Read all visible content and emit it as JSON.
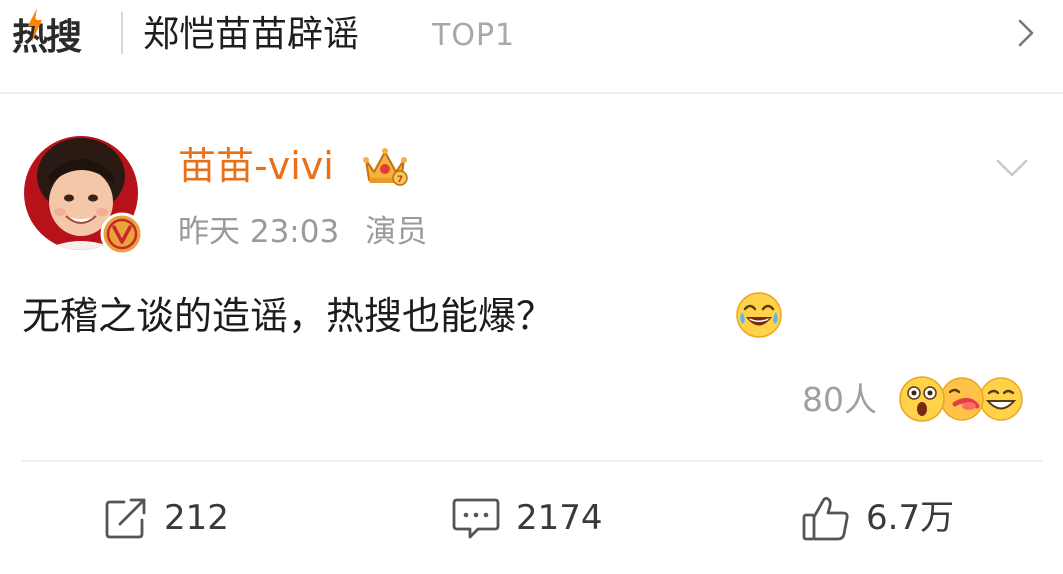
{
  "header": {
    "logo_text": "热搜",
    "topic": "郑恺苗苗辟谣",
    "rank": "TOP1"
  },
  "post": {
    "username": "苗苗-vivi",
    "time": "昨天 23:03",
    "tag": "演员",
    "content": "无稽之谈的造谣，热搜也能爆？",
    "reactions_count": "80人"
  },
  "actions": {
    "repost": "212",
    "comment": "2174",
    "like": "6.7万"
  },
  "colors": {
    "username": "#e8701a",
    "logo_spark": "#ff8200",
    "verified_badge": "#e8a33a"
  },
  "icons": [
    "hot-spark-icon",
    "chevron-right-icon",
    "crown-icon",
    "verified-badge-icon",
    "chevron-down-icon",
    "laughing-emoji-icon",
    "shocked-emoji-icon",
    "kiss-emoji-icon",
    "grin-emoji-icon",
    "repost-icon",
    "comment-icon",
    "like-icon"
  ]
}
